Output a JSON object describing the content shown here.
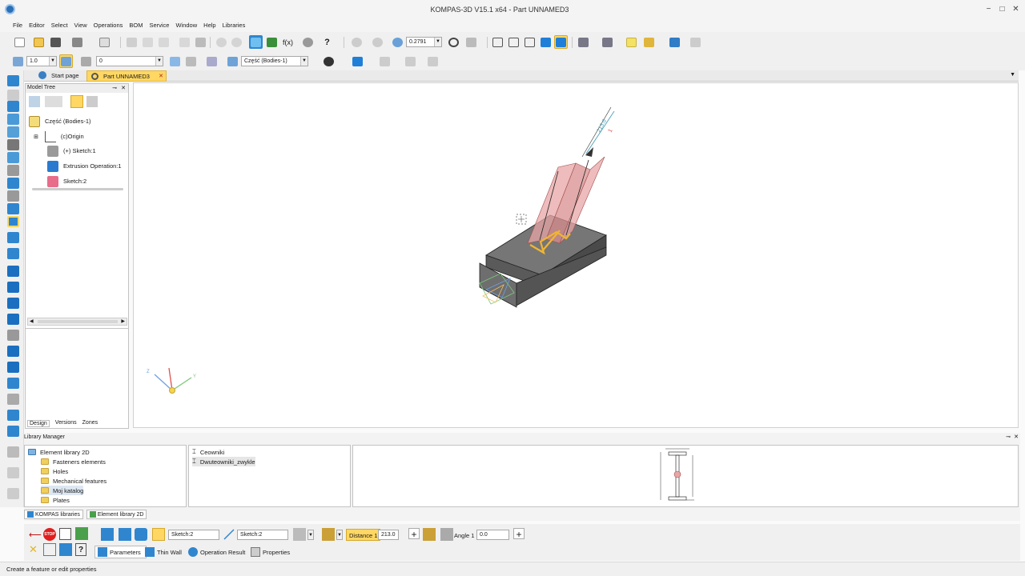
{
  "window": {
    "title": "KOMPAS-3D V15.1 x64 - Part UNNAMED3",
    "minimize": "−",
    "maximize": "□",
    "close": "✕"
  },
  "menu": [
    "File",
    "Editor",
    "Select",
    "View",
    "Operations",
    "BOM",
    "Service",
    "Window",
    "Help",
    "Libraries"
  ],
  "toolbar": {
    "zoom_value": "0.2791",
    "step_value": "1.0",
    "layer_value": "0",
    "body_value": "Część (Bodies-1)"
  },
  "tabs": [
    {
      "label": "Start page",
      "active": false
    },
    {
      "label": "Part UNNAMED3",
      "active": true,
      "close": "✕"
    }
  ],
  "model_tree": {
    "title": "Model Tree",
    "items": [
      {
        "label": "Część (Bodies-1)",
        "icon": "part-icon"
      },
      {
        "label": "(c)Origin",
        "icon": "origin-icon"
      },
      {
        "label": "(+) Sketch:1",
        "icon": "sketch-icon"
      },
      {
        "label": "Extrusion Operation:1",
        "icon": "extrusion-icon"
      },
      {
        "label": "Sketch:2",
        "icon": "sketch-icon"
      }
    ],
    "bottom_tabs": [
      "Design",
      "Versions",
      "Zones"
    ]
  },
  "library_manager": {
    "title": "Library Manager",
    "tree": [
      {
        "label": "Element library 2D",
        "indent": 0
      },
      {
        "label": "Fasteners elements",
        "indent": 1
      },
      {
        "label": "Holes",
        "indent": 1
      },
      {
        "label": "Mechanical features",
        "indent": 1
      },
      {
        "label": "Moj katalog",
        "indent": 1
      },
      {
        "label": "Plates",
        "indent": 1
      }
    ],
    "list": [
      "Ceowniki",
      "Dwuteowniki_zwykle"
    ],
    "bottom_tabs": [
      "KOMPAS libraries",
      "Element library 2D"
    ]
  },
  "property_bar": {
    "sketch1": "Sketch:2",
    "sketch2": "Sketch:2",
    "distance_label": "Distance 1",
    "distance_value": "213.0",
    "angle_label": "Angle 1",
    "angle_value": "0.0",
    "stop_label": "STOP",
    "tabs": [
      "Parameters",
      "Thin Wall",
      "Operation Result",
      "Properties"
    ]
  },
  "status": "Create a feature or edit properties",
  "colors": {
    "accent_yellow": "#ffd762",
    "toolbar_blue": "#2f86cf",
    "extrusion_pink": "#e8a0a0",
    "body_gray": "#707070"
  }
}
